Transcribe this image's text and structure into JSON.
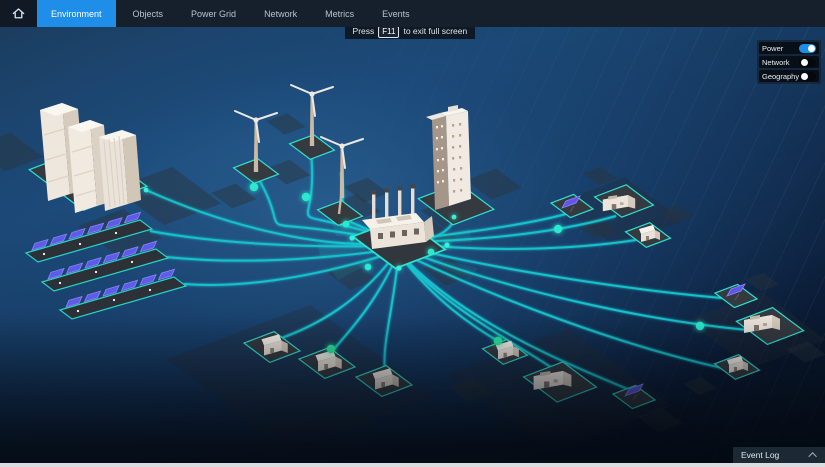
{
  "theme": {
    "accent": "#1f8ee9",
    "teal": "#2fe0d0",
    "nav-bg": "#15202c"
  },
  "navbar": {
    "home_icon": "home-icon",
    "tabs": [
      {
        "label": "Environment",
        "active": true
      },
      {
        "label": "Objects",
        "active": false
      },
      {
        "label": "Power Grid",
        "active": false
      },
      {
        "label": "Network",
        "active": false
      },
      {
        "label": "Metrics",
        "active": false
      },
      {
        "label": "Events",
        "active": false
      }
    ]
  },
  "fullscreen_toast": {
    "prefix": "Press",
    "key": "F11",
    "suffix": "to exit full screen"
  },
  "layer_toggles": [
    {
      "label": "Power",
      "on": true
    },
    {
      "label": "Network",
      "on": false
    },
    {
      "label": "Geography",
      "on": false
    }
  ],
  "event_log": {
    "label": "Event Log",
    "icon": "chevron-up-icon"
  },
  "scene": {
    "description": "Isometric smart-grid city map with a central power plant linked by glowing power lines to generators and consumers",
    "nodes": [
      {
        "id": "city-buildings",
        "kind": "commercial-block"
      },
      {
        "id": "wind-turbine-1",
        "kind": "wind-turbine"
      },
      {
        "id": "wind-turbine-2",
        "kind": "wind-turbine"
      },
      {
        "id": "wind-turbine-3",
        "kind": "wind-turbine"
      },
      {
        "id": "solar-array-1",
        "kind": "solar-array"
      },
      {
        "id": "solar-array-2",
        "kind": "solar-array"
      },
      {
        "id": "solar-array-3",
        "kind": "solar-array"
      },
      {
        "id": "office-tower",
        "kind": "office-building"
      },
      {
        "id": "power-plant",
        "kind": "power-plant"
      },
      {
        "id": "rooftop-solar-ne",
        "kind": "solar-panel"
      },
      {
        "id": "factory-ne",
        "kind": "industrial-building"
      },
      {
        "id": "house-ne",
        "kind": "house"
      },
      {
        "id": "rooftop-solar-e",
        "kind": "solar-panel"
      },
      {
        "id": "factory-e",
        "kind": "industrial-building"
      },
      {
        "id": "house-e",
        "kind": "house"
      },
      {
        "id": "house-s1",
        "kind": "house"
      },
      {
        "id": "house-s2",
        "kind": "house"
      },
      {
        "id": "house-s3",
        "kind": "house"
      },
      {
        "id": "house-se",
        "kind": "house"
      },
      {
        "id": "factory-se",
        "kind": "industrial-building"
      },
      {
        "id": "rooftop-solar-se",
        "kind": "solar-panel"
      }
    ]
  }
}
